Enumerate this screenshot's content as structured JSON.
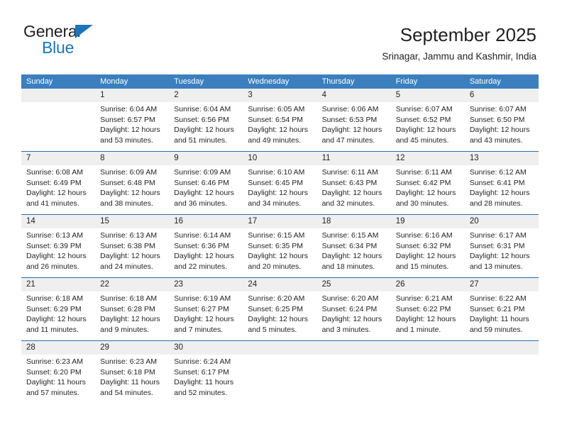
{
  "logo": {
    "word1": "General",
    "word2": "Blue",
    "triangle_color": "#1b75bb"
  },
  "header": {
    "title": "September 2025",
    "subtitle": "Srinagar, Jammu and Kashmir, India"
  },
  "theme": {
    "header_bg": "#3b7fbf",
    "week_border": "#2d6ca8",
    "daynum_band": "#efefef",
    "text": "#231f20"
  },
  "calendar": {
    "weekday_headers": [
      "Sunday",
      "Monday",
      "Tuesday",
      "Wednesday",
      "Thursday",
      "Friday",
      "Saturday"
    ],
    "weeks": [
      [
        {
          "day": "",
          "lines": []
        },
        {
          "day": "1",
          "lines": [
            "Sunrise: 6:04 AM",
            "Sunset: 6:57 PM",
            "Daylight: 12 hours",
            "and 53 minutes."
          ]
        },
        {
          "day": "2",
          "lines": [
            "Sunrise: 6:04 AM",
            "Sunset: 6:56 PM",
            "Daylight: 12 hours",
            "and 51 minutes."
          ]
        },
        {
          "day": "3",
          "lines": [
            "Sunrise: 6:05 AM",
            "Sunset: 6:54 PM",
            "Daylight: 12 hours",
            "and 49 minutes."
          ]
        },
        {
          "day": "4",
          "lines": [
            "Sunrise: 6:06 AM",
            "Sunset: 6:53 PM",
            "Daylight: 12 hours",
            "and 47 minutes."
          ]
        },
        {
          "day": "5",
          "lines": [
            "Sunrise: 6:07 AM",
            "Sunset: 6:52 PM",
            "Daylight: 12 hours",
            "and 45 minutes."
          ]
        },
        {
          "day": "6",
          "lines": [
            "Sunrise: 6:07 AM",
            "Sunset: 6:50 PM",
            "Daylight: 12 hours",
            "and 43 minutes."
          ]
        }
      ],
      [
        {
          "day": "7",
          "lines": [
            "Sunrise: 6:08 AM",
            "Sunset: 6:49 PM",
            "Daylight: 12 hours",
            "and 41 minutes."
          ]
        },
        {
          "day": "8",
          "lines": [
            "Sunrise: 6:09 AM",
            "Sunset: 6:48 PM",
            "Daylight: 12 hours",
            "and 38 minutes."
          ]
        },
        {
          "day": "9",
          "lines": [
            "Sunrise: 6:09 AM",
            "Sunset: 6:46 PM",
            "Daylight: 12 hours",
            "and 36 minutes."
          ]
        },
        {
          "day": "10",
          "lines": [
            "Sunrise: 6:10 AM",
            "Sunset: 6:45 PM",
            "Daylight: 12 hours",
            "and 34 minutes."
          ]
        },
        {
          "day": "11",
          "lines": [
            "Sunrise: 6:11 AM",
            "Sunset: 6:43 PM",
            "Daylight: 12 hours",
            "and 32 minutes."
          ]
        },
        {
          "day": "12",
          "lines": [
            "Sunrise: 6:11 AM",
            "Sunset: 6:42 PM",
            "Daylight: 12 hours",
            "and 30 minutes."
          ]
        },
        {
          "day": "13",
          "lines": [
            "Sunrise: 6:12 AM",
            "Sunset: 6:41 PM",
            "Daylight: 12 hours",
            "and 28 minutes."
          ]
        }
      ],
      [
        {
          "day": "14",
          "lines": [
            "Sunrise: 6:13 AM",
            "Sunset: 6:39 PM",
            "Daylight: 12 hours",
            "and 26 minutes."
          ]
        },
        {
          "day": "15",
          "lines": [
            "Sunrise: 6:13 AM",
            "Sunset: 6:38 PM",
            "Daylight: 12 hours",
            "and 24 minutes."
          ]
        },
        {
          "day": "16",
          "lines": [
            "Sunrise: 6:14 AM",
            "Sunset: 6:36 PM",
            "Daylight: 12 hours",
            "and 22 minutes."
          ]
        },
        {
          "day": "17",
          "lines": [
            "Sunrise: 6:15 AM",
            "Sunset: 6:35 PM",
            "Daylight: 12 hours",
            "and 20 minutes."
          ]
        },
        {
          "day": "18",
          "lines": [
            "Sunrise: 6:15 AM",
            "Sunset: 6:34 PM",
            "Daylight: 12 hours",
            "and 18 minutes."
          ]
        },
        {
          "day": "19",
          "lines": [
            "Sunrise: 6:16 AM",
            "Sunset: 6:32 PM",
            "Daylight: 12 hours",
            "and 15 minutes."
          ]
        },
        {
          "day": "20",
          "lines": [
            "Sunrise: 6:17 AM",
            "Sunset: 6:31 PM",
            "Daylight: 12 hours",
            "and 13 minutes."
          ]
        }
      ],
      [
        {
          "day": "21",
          "lines": [
            "Sunrise: 6:18 AM",
            "Sunset: 6:29 PM",
            "Daylight: 12 hours",
            "and 11 minutes."
          ]
        },
        {
          "day": "22",
          "lines": [
            "Sunrise: 6:18 AM",
            "Sunset: 6:28 PM",
            "Daylight: 12 hours",
            "and 9 minutes."
          ]
        },
        {
          "day": "23",
          "lines": [
            "Sunrise: 6:19 AM",
            "Sunset: 6:27 PM",
            "Daylight: 12 hours",
            "and 7 minutes."
          ]
        },
        {
          "day": "24",
          "lines": [
            "Sunrise: 6:20 AM",
            "Sunset: 6:25 PM",
            "Daylight: 12 hours",
            "and 5 minutes."
          ]
        },
        {
          "day": "25",
          "lines": [
            "Sunrise: 6:20 AM",
            "Sunset: 6:24 PM",
            "Daylight: 12 hours",
            "and 3 minutes."
          ]
        },
        {
          "day": "26",
          "lines": [
            "Sunrise: 6:21 AM",
            "Sunset: 6:22 PM",
            "Daylight: 12 hours",
            "and 1 minute."
          ]
        },
        {
          "day": "27",
          "lines": [
            "Sunrise: 6:22 AM",
            "Sunset: 6:21 PM",
            "Daylight: 11 hours",
            "and 59 minutes."
          ]
        }
      ],
      [
        {
          "day": "28",
          "lines": [
            "Sunrise: 6:23 AM",
            "Sunset: 6:20 PM",
            "Daylight: 11 hours",
            "and 57 minutes."
          ]
        },
        {
          "day": "29",
          "lines": [
            "Sunrise: 6:23 AM",
            "Sunset: 6:18 PM",
            "Daylight: 11 hours",
            "and 54 minutes."
          ]
        },
        {
          "day": "30",
          "lines": [
            "Sunrise: 6:24 AM",
            "Sunset: 6:17 PM",
            "Daylight: 11 hours",
            "and 52 minutes."
          ]
        },
        {
          "day": "",
          "lines": []
        },
        {
          "day": "",
          "lines": []
        },
        {
          "day": "",
          "lines": []
        },
        {
          "day": "",
          "lines": []
        }
      ]
    ]
  }
}
